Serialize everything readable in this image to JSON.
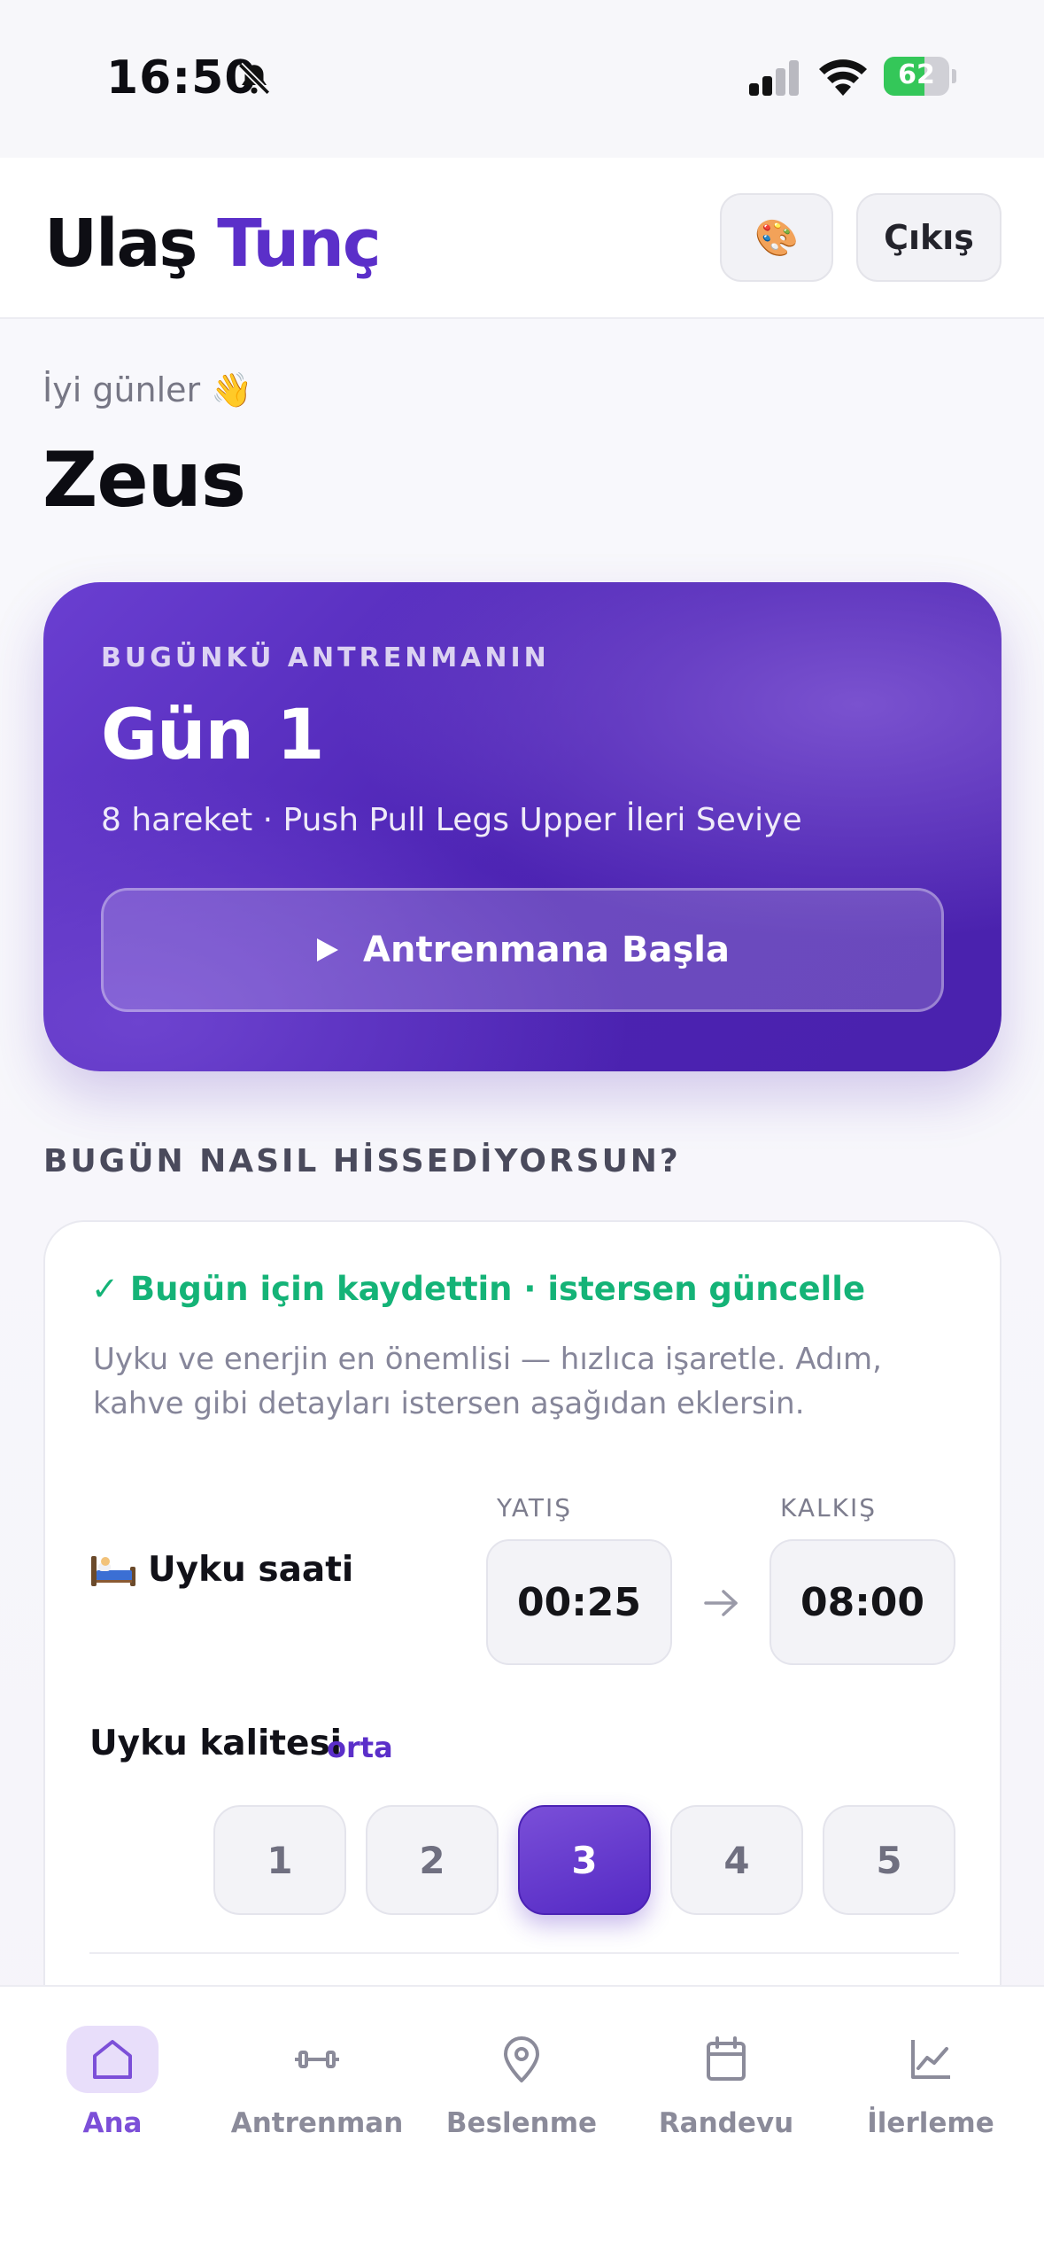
{
  "status_bar": {
    "time": "16:50",
    "battery": "62",
    "battery_level": 0.62
  },
  "header": {
    "brand_first": "Ulaş",
    "brand_last": "Tunç",
    "theme_icon": "🎨",
    "logout_label": "Çıkış"
  },
  "greeting": {
    "text": "İyi günler 👋",
    "name": "Zeus"
  },
  "hero": {
    "eyebrow": "BUGÜNKÜ ANTRENMANIN",
    "title": "Gün 1",
    "subtitle": "8 hareket · Push Pull Legs Upper İleri Seviye",
    "cta_label": "Antrenmana Başla"
  },
  "checkin": {
    "section_title": "BUGÜN NASIL HİSSEDİYORSUN?",
    "saved_text": "✓ Bugün için kaydettin · istersen güncelle",
    "hint": "Uyku ve enerjin en önemlisi — hızlıca işaretle. Adım, kahve gibi detayları istersen aşağıdan eklersin.",
    "sleep_label": "Uyku saati",
    "bed_label": "YATIŞ",
    "wake_label": "KALKIŞ",
    "bed_time": "00:25",
    "wake_time": "08:00",
    "quality_label": "Uyku kalitesi",
    "quality_value": "orta",
    "ratings": [
      "1",
      "2",
      "3",
      "4",
      "5"
    ],
    "selected_rating": "3"
  },
  "nav": {
    "items": [
      {
        "label": "Ana",
        "icon": "home-icon",
        "active": true
      },
      {
        "label": "Antrenman",
        "icon": "dumbbell-icon",
        "active": false
      },
      {
        "label": "Beslenme",
        "icon": "location-pin-icon",
        "active": false
      },
      {
        "label": "Randevu",
        "icon": "calendar-icon",
        "active": false
      },
      {
        "label": "İlerleme",
        "icon": "chart-icon",
        "active": false
      }
    ]
  },
  "colors": {
    "accent": "#5b2fc9",
    "success": "#14b377",
    "nav_active": "#7c4fd8"
  }
}
